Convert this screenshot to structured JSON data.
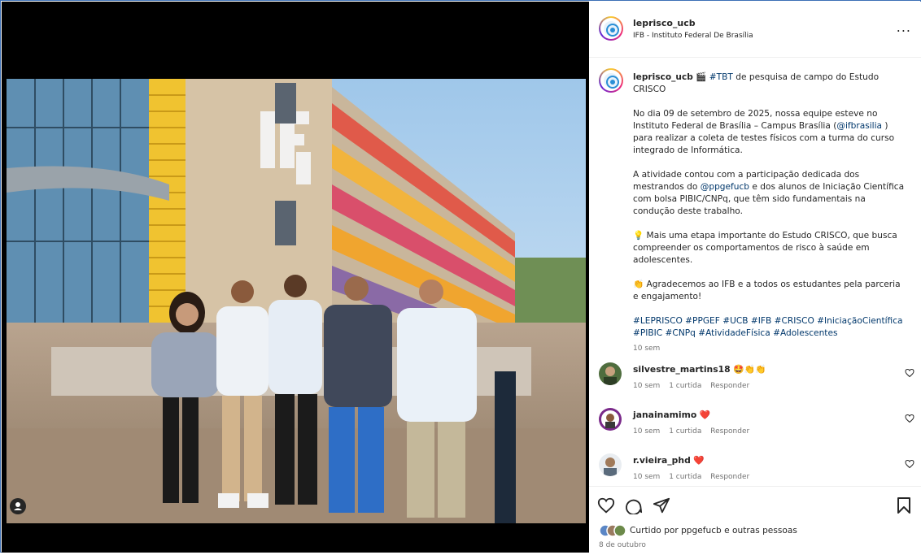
{
  "header": {
    "username": "leprisco_ucb",
    "location": "IFB - Instituto Federal De Brasília",
    "more_label": "..."
  },
  "caption": {
    "username": "leprisco_ucb",
    "emoji": "🎬",
    "hashtag_tbt": "#TBT",
    "title_rest": " de pesquisa de campo do Estudo CRISCO",
    "p1_a": "No dia 09 de setembro de 2025, nossa equipe esteve no Instituto Federal de Brasília – Campus Brasília (",
    "p1_mention": "@ifbrasilia",
    "p1_b": " ) para realizar a coleta de testes físicos com a turma do curso integrado de Informática.",
    "p2_a": "A atividade contou com a participação dedicada dos mestrandos do ",
    "p2_mention": "@ppgefucb",
    "p2_b": " e dos alunos de Iniciação Científica com bolsa PIBIC/CNPq, que têm sido fundamentais na condução deste trabalho.",
    "p3": "💡 Mais uma etapa importante do Estudo CRISCO, que busca compreender os comportamentos de risco à saúde em adolescentes.",
    "p4": "👏 Agradecemos ao IFB e a todos os estudantes pela parceria e engajamento!",
    "hashtags": "#LEPRISCO #PPGEF #UCB #IFB #CRISCO #IniciaçãoCientífica #PIBIC #CNPq #AtividadeFísica #Adolescentes",
    "time": "10 sem"
  },
  "comments": [
    {
      "username": "silvestre_martins18",
      "text": "🤩👏👏",
      "time": "10 sem",
      "likes": "1 curtida",
      "reply": "Responder"
    },
    {
      "username": "janainamimo",
      "text": "❤️",
      "time": "10 sem",
      "likes": "1 curtida",
      "reply": "Responder"
    },
    {
      "username": "r.vieira_phd",
      "text": "❤️",
      "time": "10 sem",
      "likes": "1 curtida",
      "reply": "Responder"
    }
  ],
  "footer": {
    "liked_by": "Curtido por ppgefucb e outras pessoas",
    "date": "8 de outubro"
  },
  "colors": {
    "link": "#00376b",
    "meta": "#737373",
    "text": "#262626",
    "heart": "#ed4956",
    "frame": "#3b6fb6"
  },
  "icons": [
    "user-tag-icon",
    "more-icon",
    "heart-icon",
    "comment-icon",
    "share-icon",
    "bookmark-icon"
  ]
}
